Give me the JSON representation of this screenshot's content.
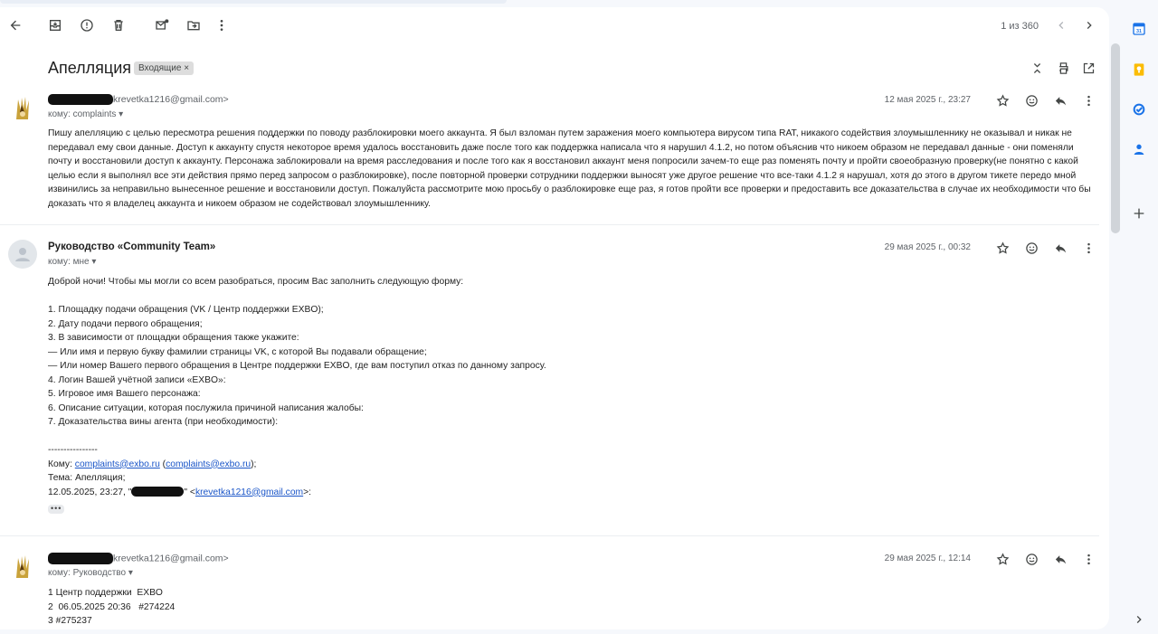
{
  "toolbar": {
    "back_icon": "arrow-back-icon",
    "archive_icon": "archive-icon",
    "report_icon": "report-spam-icon",
    "delete_icon": "trash-icon",
    "mark_unread_icon": "mark-unread-icon",
    "move_icon": "move-to-folder-icon",
    "more_icon": "more-vert-icon",
    "pager_text": "1 из 360"
  },
  "thread": {
    "subject": "Апелляция",
    "label": "Входящие ×"
  },
  "messages": [
    {
      "sender_name": "",
      "sender_email": "krevetka1216@gmail.com>",
      "to": "кому: complaints",
      "date": "12 мая 2025 г., 23:27",
      "body": "Пишу апелляцию с целью пересмотра решения поддержки по поводу разблокировки моего аккаунта. Я был взломан путем заражения моего компьютера вирусом типа RAT, никакого содействия злоумышленнику не оказывал и никак не передавал ему свои данные. Доступ к аккаунту спустя некоторое время удалось восстановить даже после того как поддержка написала что я нарушил 4.1.2, но потом объяснив что никоем образом не передавал данные - они поменяли почту и восстановили доступ к аккаунту. Персонажа заблокировали на время расследования и после того как я восстановил аккаунт меня попросили зачем-то еще раз поменять почту и пройти своеобразную проверку(не понятно с какой целью если я выполнял все эти действия прямо перед запросом о разблокировке), после повторной проверки сотрудники поддержки выносят уже другое решение что все-таки 4.1.2 я нарушал, хотя до этого в другом тикете передо мной извинились за неправильно вынесенное решение и восстановили доступ. Пожалуйста рассмотрите мою просьбу о разблокировке еще раз, я готов пройти все проверки и предоставить все доказательства в случае их необходимости что бы доказать что я владелец аккаунта и никоем образом не содействовал злоумышленнику."
    },
    {
      "sender_name": "Руководство «Community Team»",
      "to": "кому: мне",
      "date": "29 мая 2025 г., 00:32",
      "greeting": "Доброй ночи! Чтобы мы могли со всем разобраться, просим Вас заполнить следующую форму:",
      "lines": [
        "1. Площадку подачи обращения (VK / Центр поддержки EXBO);",
        "2. Дату подачи первого обращения;",
        "3. В зависимости от площадки обращения также укажите:",
        "— Или имя и первую букву фамилии страницы VK, с которой Вы подавали обращение;",
        "— Или номер Вашего первого обращения в Центре поддержки EXBO, где вам поступил отказ по данному запросу.",
        "4. Логин Вашей учётной записи «EXBO»:",
        "5. Игровое имя Вашего персонажа:",
        "6. Описание ситуации, которая послужила причиной написания жалобы:",
        "7. Доказательства вины агента (при необходимости):"
      ],
      "separator": "----------------",
      "quote_to_label": "Кому: ",
      "quote_to_link1": "complaints@exbo.ru",
      "quote_to_link2": "complaints@exbo.ru",
      "quote_subject": "Тема: Апелляция;",
      "quote_date": "12.05.2025, 23:27, \"",
      "quote_email": "krevetka1216@gmail.com",
      "ellipsis": "•••"
    },
    {
      "sender_name": "",
      "sender_email": "krevetka1216@gmail.com>",
      "to": "кому: Руководство",
      "date": "29 мая 2025 г., 12:14",
      "lines": [
        "1 Центр поддержки  EXBO",
        "2  06.05.2025 20:36   #274224",
        "3 #275237"
      ]
    }
  ],
  "colors": {
    "accent": "#1a73e8",
    "link": "#1a55c8",
    "calendar": "#1a73e8",
    "keep": "#fbbc04",
    "tasks": "#1a73e8",
    "contacts": "#1a73e8"
  }
}
